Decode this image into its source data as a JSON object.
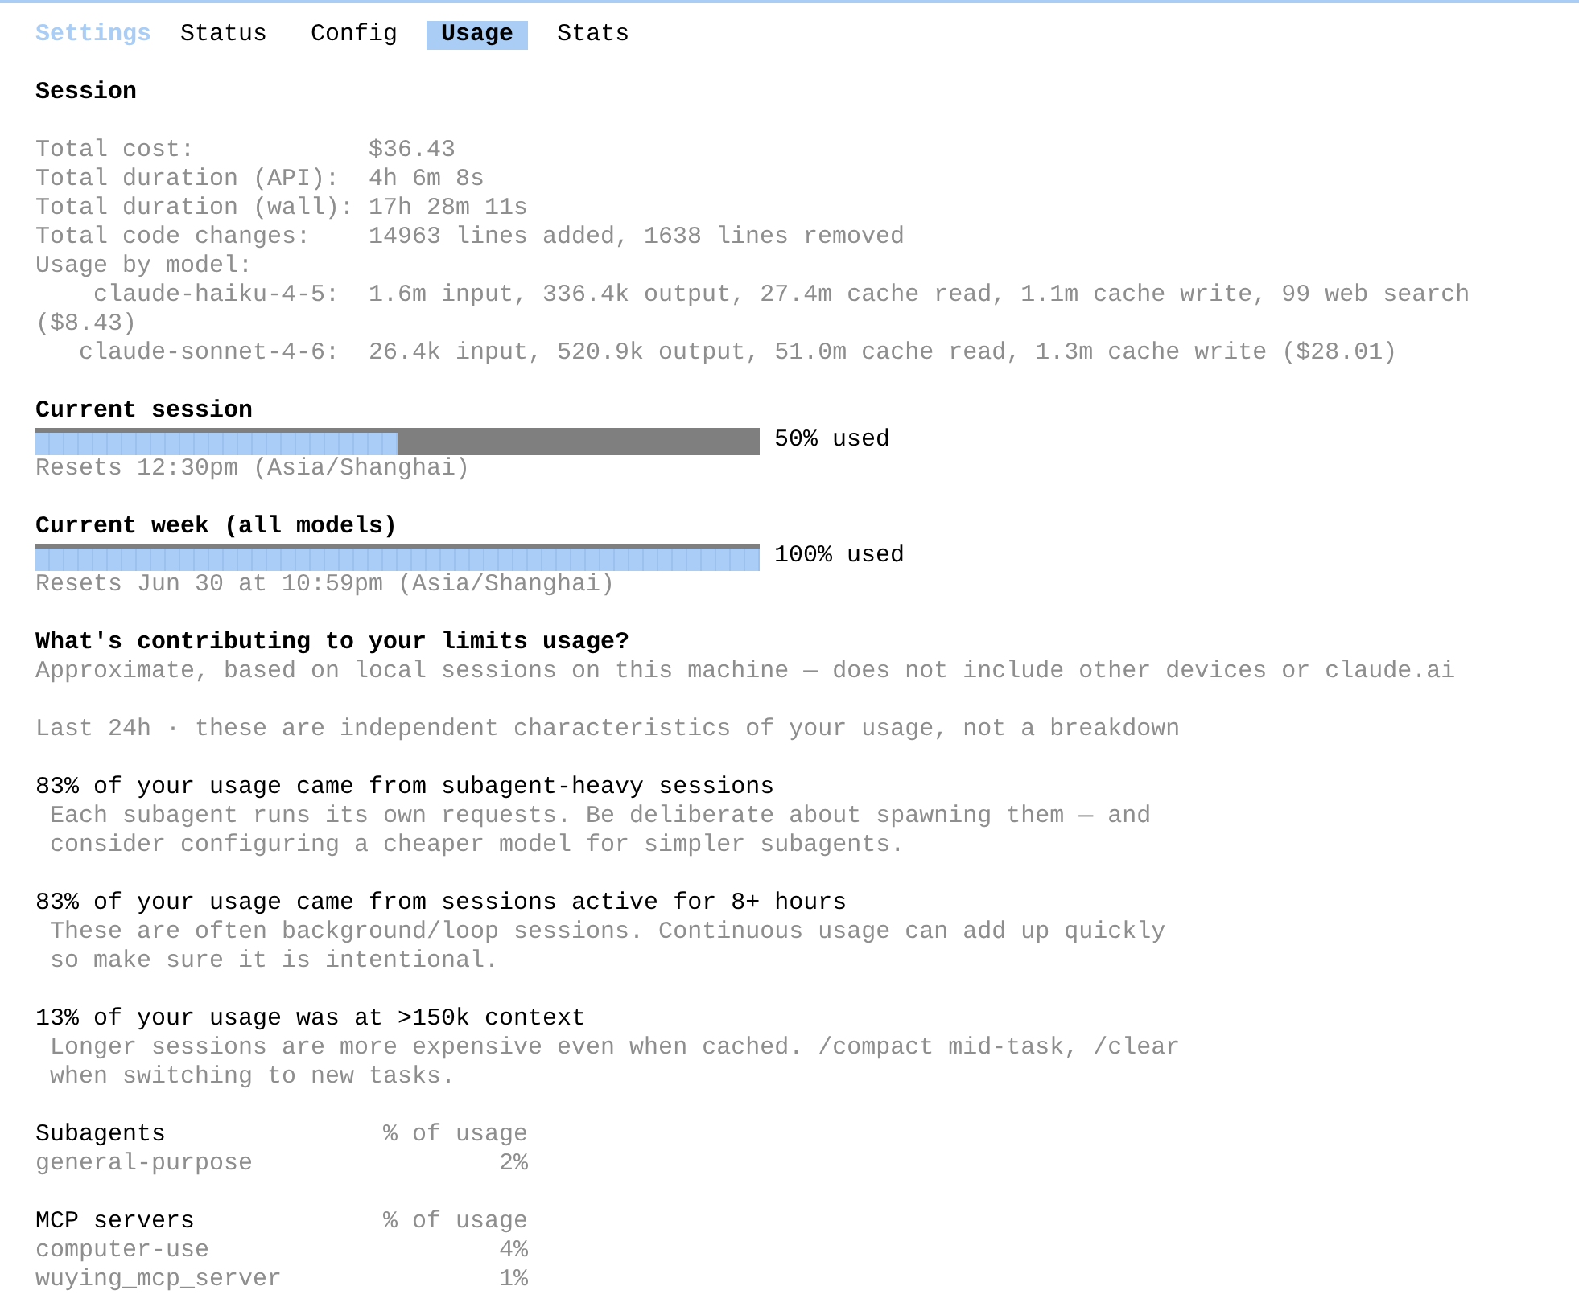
{
  "tabs": {
    "title": "Settings",
    "items": [
      {
        "label": "Status",
        "selected": false
      },
      {
        "label": "Config",
        "selected": false
      },
      {
        "label": "Usage",
        "selected": true
      },
      {
        "label": "Stats",
        "selected": false
      }
    ]
  },
  "session": {
    "heading": "Session",
    "stats": [
      {
        "label": "Total cost:",
        "value": "$36.43"
      },
      {
        "label": "Total duration (API):",
        "value": "4h 6m 8s"
      },
      {
        "label": "Total duration (wall):",
        "value": "17h 28m 11s"
      },
      {
        "label": "Total code changes:",
        "value": "14963 lines added, 1638 lines removed"
      }
    ],
    "models_heading": "Usage by model:",
    "models": [
      {
        "name": "claude-haiku-4-5:",
        "usage": "1.6m input, 336.4k output, 27.4m cache read, 1.1m cache write, 99 web search ($8.43)"
      },
      {
        "name": "claude-sonnet-4-6:",
        "usage": "26.4k input, 520.9k output, 51.0m cache read, 1.3m cache write ($28.01)"
      }
    ]
  },
  "limits": [
    {
      "title": "Current session",
      "level": 0.5,
      "reading": "50% used",
      "resets": "Resets 12:30pm (Asia/Shanghai)"
    },
    {
      "title": "Current week (all models)",
      "level": 1,
      "reading": "100% used",
      "resets": "Resets Jun 30 at 10:59pm (Asia/Shanghai)"
    }
  ],
  "contributions": {
    "heading": "What's contributing to your limits usage?",
    "note": "Approximate, based on local sessions on this machine — does not include other devices or claude.ai",
    "period": "Last 24h · these are independent characteristics of your usage, not a breakdown",
    "insights": [
      {
        "title": "83% of your usage came from subagent-heavy sessions",
        "detail": "Each subagent runs its own requests. Be deliberate about spawning them — and consider configuring a cheaper model for simpler subagents."
      },
      {
        "title": "83% of your usage came from sessions active for 8+ hours",
        "detail": "These are often background/loop sessions. Continuous usage can add up quickly so make sure it is intentional."
      },
      {
        "title": "13% of your usage was at >150k context",
        "detail": "Longer sessions are more expensive even when cached. /compact mid-task, /clear when switching to new tasks."
      }
    ]
  },
  "breakdowns": [
    {
      "name": "Subagents",
      "column": "% of usage",
      "rows": [
        {
          "name": "general-purpose",
          "share": "2%"
        }
      ]
    },
    {
      "name": "MCP servers",
      "column": "% of usage",
      "rows": [
        {
          "name": "computer-use",
          "share": "4%"
        },
        {
          "name": "wuying_mcp_server",
          "share": "1%"
        }
      ]
    }
  ]
}
